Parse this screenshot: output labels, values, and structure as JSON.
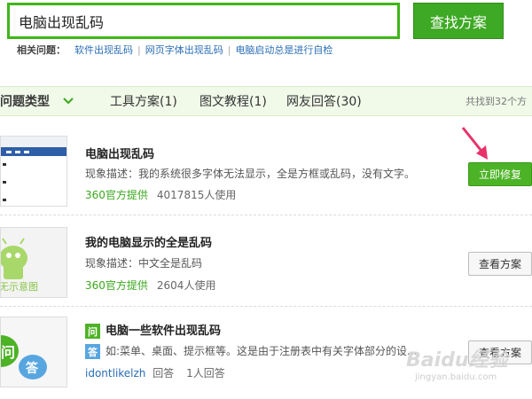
{
  "search": {
    "value": "电脑出现乱码",
    "button_label": "查找方案"
  },
  "related": {
    "label": "相关问题：",
    "items": [
      "软件出现乱码",
      "网页字体出现乱码",
      "电脑启动总是进行自检"
    ]
  },
  "filter": {
    "type_label": "问题类型",
    "tabs": [
      "工具方案(1)",
      "图文教程(1)",
      "网友回答(30)"
    ],
    "total": "共找到32个方"
  },
  "results": [
    {
      "title": "电脑出现乱码",
      "desc": "现象描述：我的系统很多字体无法显示，全是方框或乱码，没有文字。",
      "source": "360官方提供",
      "uses": "4017815人使用",
      "button": "立即修复"
    },
    {
      "title": "我的电脑显示的全是乱码",
      "desc": "现象描述：中文全是乱码",
      "source": "360官方提供",
      "uses": "2604人使用",
      "button": "查看方案",
      "thumb_text": "无示意图"
    },
    {
      "q_badge": "问",
      "title": "电脑一些软件出现乱码",
      "a_badge": "答",
      "desc": "如:菜单、桌面、提示框等。这是由于注册表中有关字体部分的设...",
      "user": "idontlikelzh",
      "answer_label": "回答",
      "count": "1人回答",
      "button": "查看方案",
      "thumb_text": "答"
    }
  ],
  "watermark": {
    "main": "Baidu经验",
    "sub": "jingyan.baidu.com"
  },
  "colors": {
    "accent": "#3fb618",
    "link": "#2a6db5",
    "arrow": "#e8326a"
  }
}
